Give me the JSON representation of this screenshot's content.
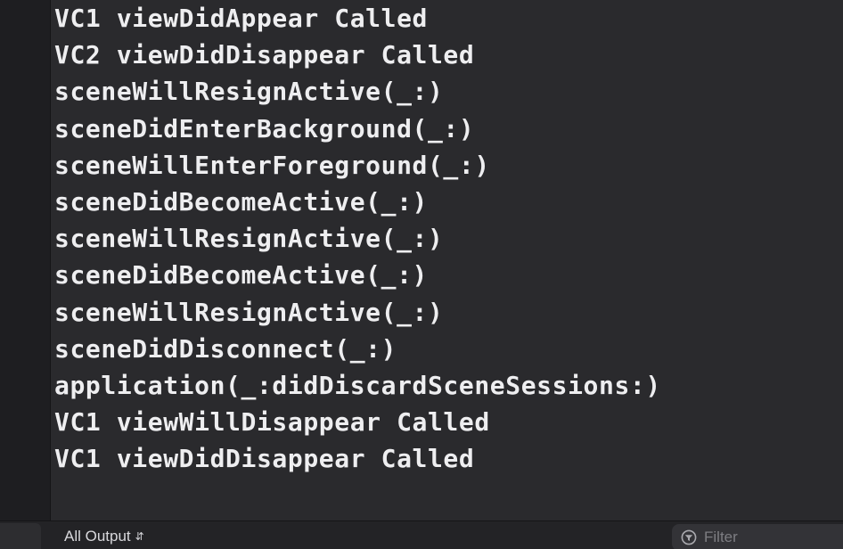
{
  "console": {
    "lines": [
      "VC1 viewDidAppear Called",
      "VC2 viewDidDisappear Called",
      "sceneWillResignActive(_:)",
      "sceneDidEnterBackground(_:)",
      "sceneWillEnterForeground(_:)",
      "sceneDidBecomeActive(_:)",
      "sceneWillResignActive(_:)",
      "sceneDidBecomeActive(_:)",
      "sceneWillResignActive(_:)",
      "sceneDidDisconnect(_:)",
      "application(_:didDiscardSceneSessions:)",
      "VC1 viewWillDisappear Called",
      "VC1 viewDidDisappear Called"
    ]
  },
  "footer": {
    "output_selector": "All Output",
    "filter_placeholder": "Filter"
  },
  "icons": {
    "output_chevron": "up-down-chevron-icon",
    "filter": "filter-icon"
  },
  "colors": {
    "background": "#2a2a2d",
    "text": "#eeeef0",
    "placeholder": "#7d7d82"
  }
}
